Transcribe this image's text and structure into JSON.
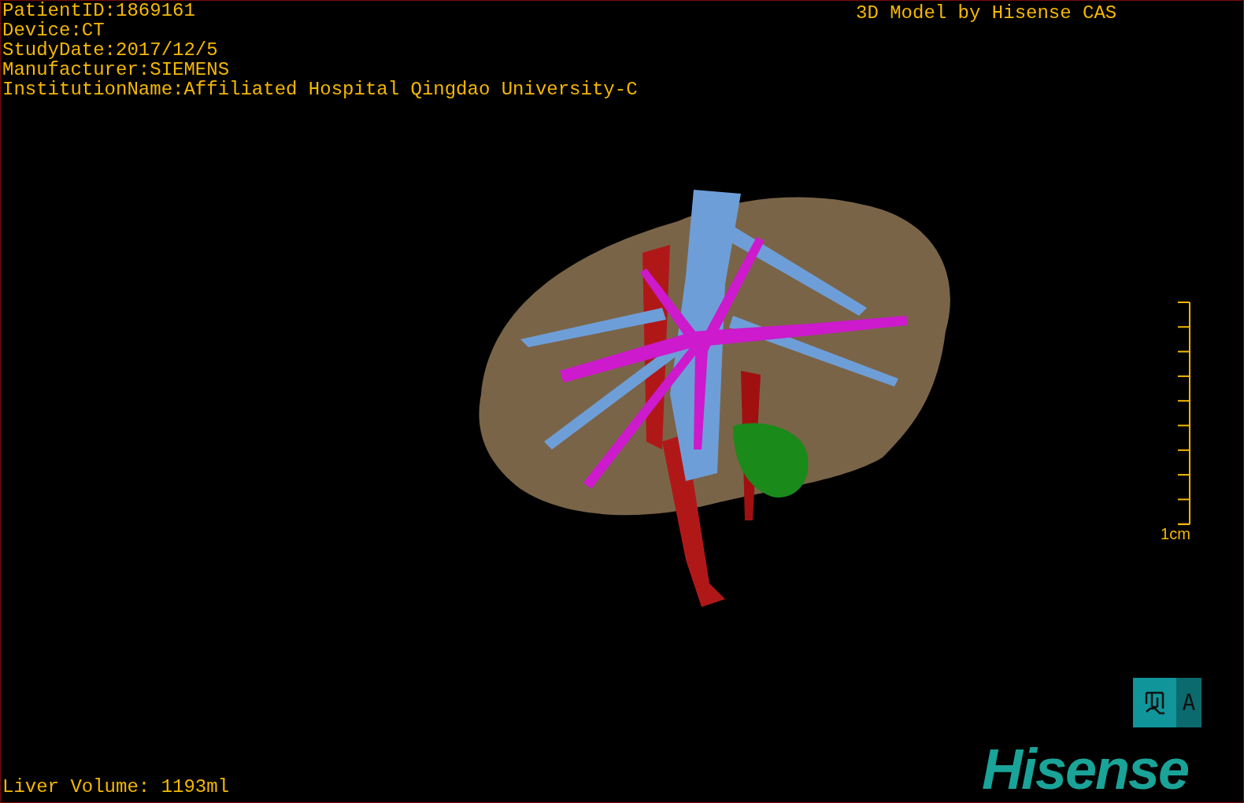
{
  "patient_info": [
    "PatientID:1869161",
    "Device:CT",
    "StudyDate:2017/12/5",
    "Manufacturer:SIEMENS",
    "InstitutionName:Affiliated Hospital Qingdao University-C"
  ],
  "model_credit": "3D Model by Hisense CAS",
  "scale_bar": {
    "label": "1cm"
  },
  "orientation_marker": {
    "label": "A"
  },
  "liver_volume": "Liver Volume: 1193ml",
  "logo": "Hisense"
}
